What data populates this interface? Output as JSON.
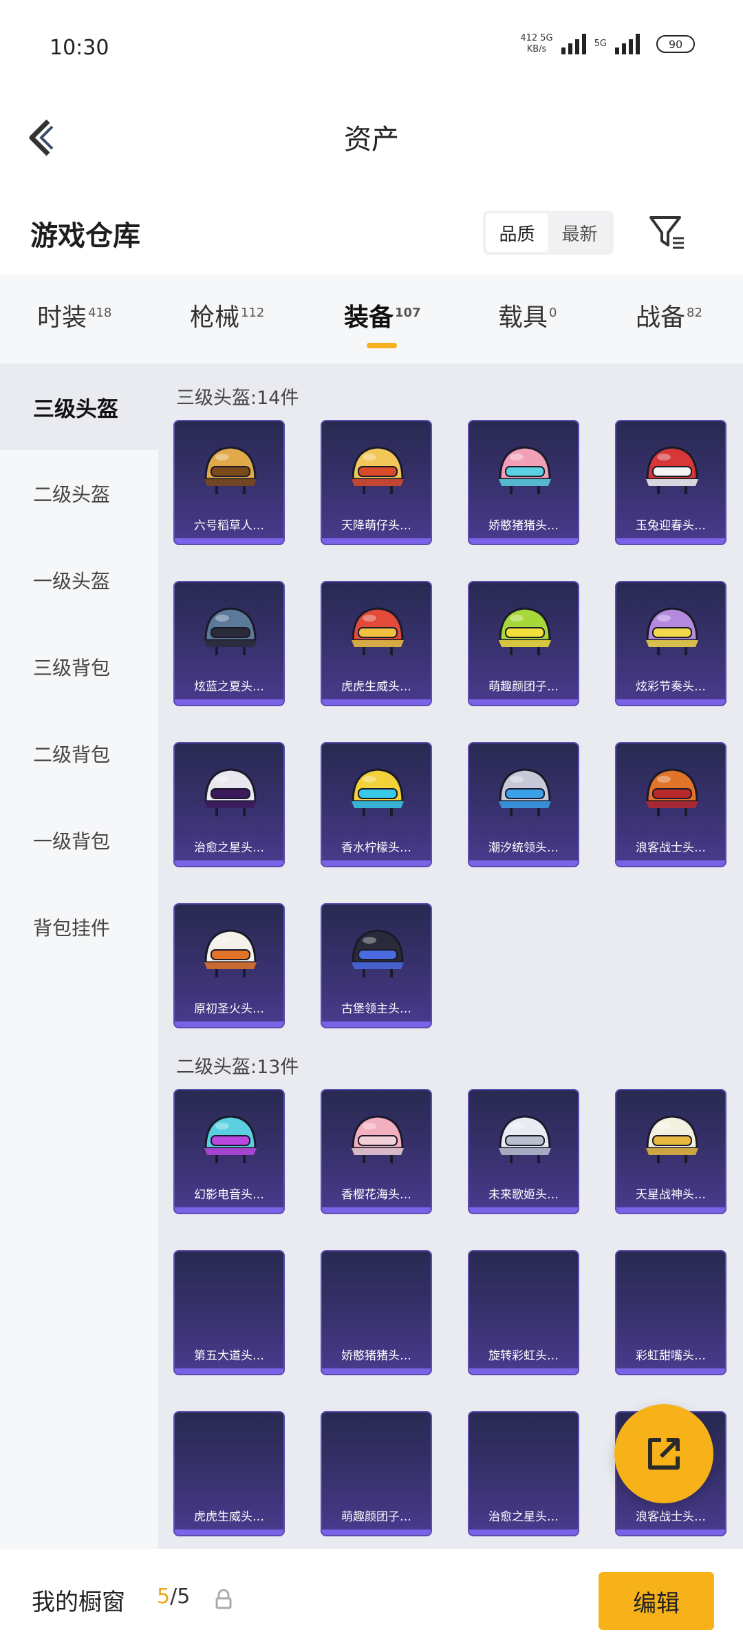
{
  "status_bar": {
    "time": "10:30",
    "net_speed_top": "412 5G",
    "net_speed_bottom": "KB/s",
    "sim2_label": "5G",
    "battery": "90"
  },
  "header": {
    "title": "资产"
  },
  "section": {
    "title": "游戏仓库",
    "sort_options": [
      "品质",
      "最新"
    ],
    "active_sort": "品质"
  },
  "tabs": [
    {
      "label": "时装",
      "count": "418"
    },
    {
      "label": "枪械",
      "count": "112"
    },
    {
      "label": "装备",
      "count": "107"
    },
    {
      "label": "载具",
      "count": "0"
    },
    {
      "label": "战备",
      "count": "82"
    }
  ],
  "active_tab": "装备",
  "sidebar": {
    "items": [
      "三级头盔",
      "二级头盔",
      "一级头盔",
      "三级背包",
      "二级背包",
      "一级背包",
      "背包挂件"
    ],
    "active": "三级头盔"
  },
  "groups": [
    {
      "title": "三级头盔:14件",
      "items": [
        {
          "name": "六号稻草人…",
          "icon": "scarecrow-helmet-icon",
          "color": "#e0a94a",
          "accent": "#7a4a1a"
        },
        {
          "name": "天降萌仔头…",
          "icon": "yellow-helmet-icon",
          "color": "#f1c75a",
          "accent": "#d94a2a"
        },
        {
          "name": "娇憨猪猪头…",
          "icon": "pink-pig-helmet-icon",
          "color": "#f2a0b8",
          "accent": "#5ad0e0"
        },
        {
          "name": "玉兔迎春头…",
          "icon": "red-white-helmet-icon",
          "color": "#d8373a",
          "accent": "#f4f4f4"
        },
        {
          "name": "炫蓝之夏头…",
          "icon": "blue-goggles-helmet-icon",
          "color": "#5b7a9a",
          "accent": "#2a2a3a"
        },
        {
          "name": "虎虎生威头…",
          "icon": "tiger-helmet-icon",
          "color": "#e24a3a",
          "accent": "#f2c040"
        },
        {
          "name": "萌趣颜团子…",
          "icon": "green-sprout-helmet-icon",
          "color": "#a6d83a",
          "accent": "#f2e03a"
        },
        {
          "name": "炫彩节奏头…",
          "icon": "party-helmet-icon",
          "color": "#b48adf",
          "accent": "#f2d84a"
        },
        {
          "name": "治愈之星头…",
          "icon": "black-visor-helmet-icon",
          "color": "#e8e8ee",
          "accent": "#3a1a5a"
        },
        {
          "name": "香水柠檬头…",
          "icon": "lemon-helmet-icon",
          "color": "#f2d23a",
          "accent": "#3ac8e8"
        },
        {
          "name": "潮汐统领头…",
          "icon": "tide-helmet-icon",
          "color": "#c8c8d8",
          "accent": "#3aa0e8"
        },
        {
          "name": "浪客战士头…",
          "icon": "samurai-helmet-icon",
          "color": "#e2742a",
          "accent": "#b8282a"
        },
        {
          "name": "原初圣火头…",
          "icon": "orange-white-helmet-icon",
          "color": "#f4f0ea",
          "accent": "#e2742a"
        },
        {
          "name": "古堡领主头…",
          "icon": "dark-dragon-helmet-icon",
          "color": "#2a2a3a",
          "accent": "#4a6adf"
        }
      ]
    },
    {
      "title": "二级头盔:13件",
      "items": [
        {
          "name": "幻影电音头…",
          "icon": "neon-helmet-icon",
          "color": "#5ad0e0",
          "accent": "#b848e0"
        },
        {
          "name": "香樱花海头…",
          "icon": "pink-sakura-helmet-icon",
          "color": "#f2b0c0",
          "accent": "#f2d0d8"
        },
        {
          "name": "未来歌姬头…",
          "icon": "white-future-helmet-icon",
          "color": "#e8ecf2",
          "accent": "#b8c0d0"
        },
        {
          "name": "天星战神头…",
          "icon": "gold-white-helmet-icon",
          "color": "#f4f0e0",
          "accent": "#e8b840"
        },
        {
          "name": "第五大道头…",
          "icon": "",
          "color": "",
          "accent": ""
        },
        {
          "name": "娇憨猪猪头…",
          "icon": "",
          "color": "",
          "accent": ""
        },
        {
          "name": "旋转彩虹头…",
          "icon": "",
          "color": "",
          "accent": ""
        },
        {
          "name": "彩虹甜嘴头…",
          "icon": "",
          "color": "",
          "accent": ""
        },
        {
          "name": "虎虎生威头…",
          "icon": "",
          "color": "",
          "accent": ""
        },
        {
          "name": "萌趣颜团子…",
          "icon": "",
          "color": "",
          "accent": ""
        },
        {
          "name": "治愈之星头…",
          "icon": "",
          "color": "",
          "accent": ""
        },
        {
          "name": "浪客战士头…",
          "icon": "",
          "color": "",
          "accent": ""
        }
      ]
    }
  ],
  "bottom_bar": {
    "label": "我的橱窗",
    "current": "5",
    "separator": "/",
    "total": "5",
    "edit_label": "编辑"
  },
  "colors": {
    "accent": "#f8b219",
    "card_bg": "#312d62",
    "card_strip": "#7b63e8"
  }
}
